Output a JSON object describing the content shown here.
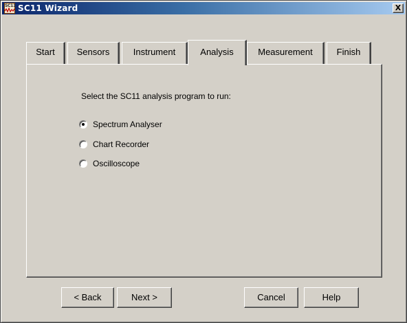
{
  "window": {
    "title": "SC11 Wizard",
    "icon": "sc11-app-icon",
    "icon_text": "SC11",
    "close_label": "X"
  },
  "tabs": [
    {
      "label": "Start",
      "active": false
    },
    {
      "label": "Sensors",
      "active": false
    },
    {
      "label": "Instrument",
      "active": false
    },
    {
      "label": "Analysis",
      "active": true
    },
    {
      "label": "Measurement",
      "active": false
    },
    {
      "label": "Finish",
      "active": false
    }
  ],
  "analysis": {
    "prompt": "Select the SC11 analysis program to run:",
    "options": [
      {
        "label": "Spectrum Analyser",
        "selected": true
      },
      {
        "label": "Chart Recorder",
        "selected": false
      },
      {
        "label": "Oscilloscope",
        "selected": false
      }
    ]
  },
  "buttons": {
    "back": "< Back",
    "next": "Next >",
    "cancel": "Cancel",
    "help": "Help"
  }
}
